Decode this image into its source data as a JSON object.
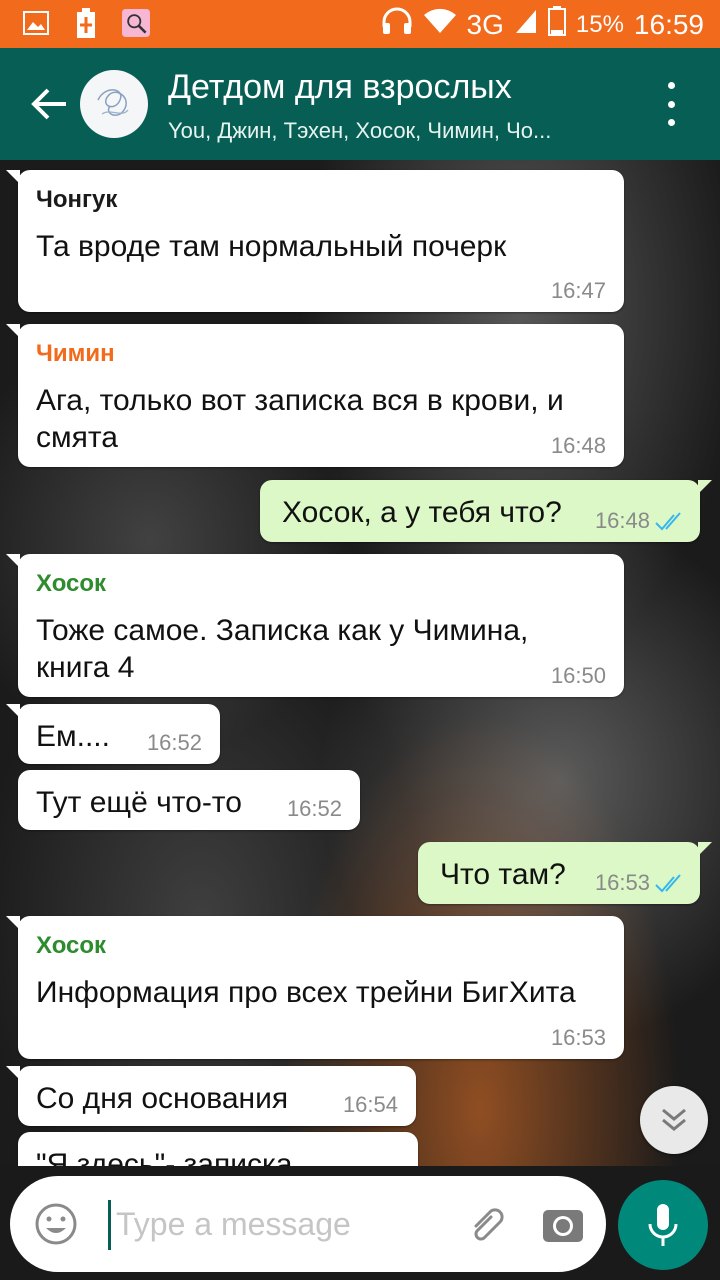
{
  "status_bar": {
    "network": "3G",
    "battery": "15%",
    "time": "16:59",
    "icons": [
      "gallery-icon",
      "battery-saver-icon",
      "app-notification-icon",
      "headphones-icon",
      "wifi-icon",
      "signal-icon",
      "battery-icon"
    ]
  },
  "header": {
    "title": "Детдом для взрослых",
    "subtitle": "You, Джин, Тэхен, Хосок, Чимин, Чо...",
    "back_icon": "arrow-left-icon",
    "menu_icon": "more-vert-icon"
  },
  "messages": [
    {
      "dir": "in",
      "sender": "Чонгук",
      "sender_color": "#1a1a1a",
      "text": "Та вроде там нормальный почерк",
      "time": "16:47"
    },
    {
      "dir": "in",
      "sender": "Чимин",
      "sender_color": "#f26a1b",
      "text": "Ага, только вот записка вся в крови, и смята",
      "time": "16:48"
    },
    {
      "dir": "out",
      "text": "Хосок, а у тебя что?",
      "time": "16:48",
      "read": true
    },
    {
      "dir": "in",
      "sender": "Хосок",
      "sender_color": "#2e8b2e",
      "text": "Тоже самое. Записка как у Чимина, книга 4",
      "time": "16:50"
    },
    {
      "dir": "in",
      "text": "Ем....",
      "time": "16:52"
    },
    {
      "dir": "in",
      "text": "Тут ещё что-то",
      "time": "16:52"
    },
    {
      "dir": "out",
      "text": "Что там?",
      "time": "16:53",
      "read": true
    },
    {
      "dir": "in",
      "sender": "Хосок",
      "sender_color": "#2e8b2e",
      "text": "Информация про всех трейни БигХита",
      "time": "16:53"
    },
    {
      "dir": "in",
      "text": "Со дня основания",
      "time": "16:54"
    },
    {
      "dir": "in",
      "text": "\"Я здесь\"- записка",
      "time": ""
    }
  ],
  "input": {
    "placeholder": "Type a message"
  },
  "colors": {
    "status_bar": "#f26a1b",
    "app_bar": "#075e54",
    "outgoing_bubble": "#dcf8c6",
    "incoming_bubble": "#ffffff",
    "mic_button": "#00897b",
    "read_ticks": "#34b7f1"
  }
}
